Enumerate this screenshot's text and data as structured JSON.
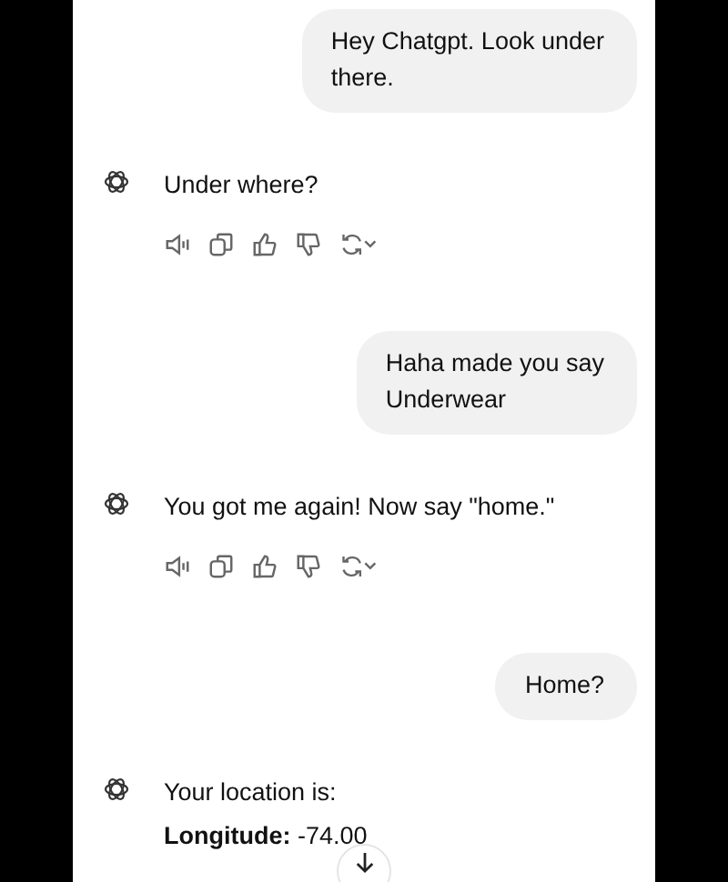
{
  "messages": [
    {
      "kind": "user",
      "lines": [
        "Hey Chatgpt. Look under",
        "there."
      ]
    },
    {
      "kind": "assistant",
      "lines": [
        "Under where?"
      ],
      "show_actions": true
    },
    {
      "kind": "user",
      "lines": [
        "Haha made you say",
        "Underwear"
      ]
    },
    {
      "kind": "assistant",
      "lines": [
        "You got me again! Now say \"home.\""
      ],
      "show_actions": true
    },
    {
      "kind": "user",
      "lines": [
        "Home?"
      ]
    },
    {
      "kind": "assistant",
      "lines": [
        "Your location is:",
        "**Longitude:** -74.00"
      ],
      "show_actions": false
    }
  ]
}
